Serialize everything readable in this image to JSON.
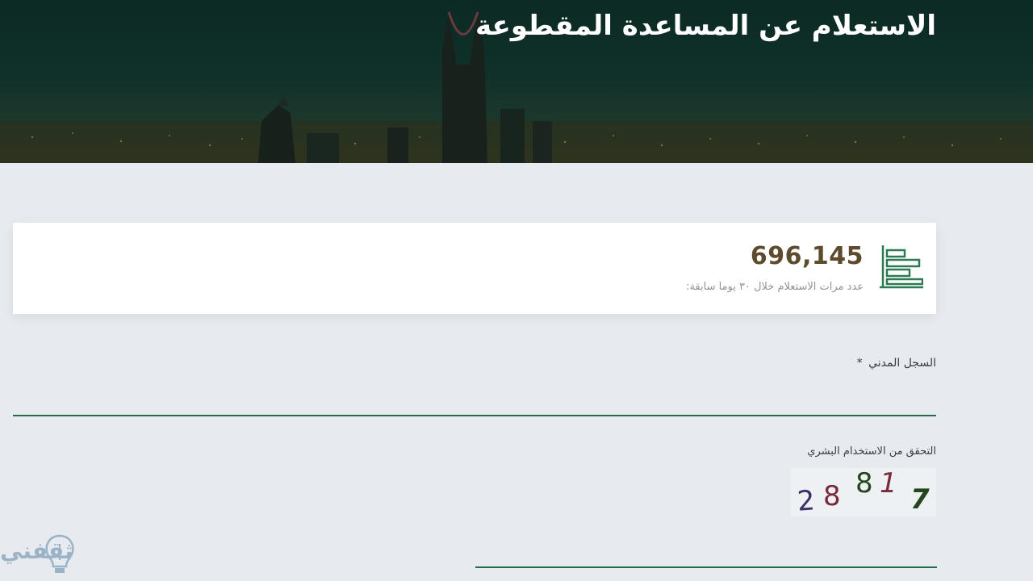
{
  "hero": {
    "title": "الاستعلام عن المساعدة المقطوعة"
  },
  "stats": {
    "count": "696,145",
    "caption": "عدد مرات الاستعلام خلال ٣٠ يوما سابقة:",
    "icon": "bar-chart-icon"
  },
  "form": {
    "national_id": {
      "label": "السجل المدني",
      "required_mark": "*",
      "value": ""
    },
    "captcha": {
      "label": "التحقق من الاستخدام البشري",
      "value": "",
      "characters": [
        "2",
        "8",
        "8",
        "1",
        "7"
      ]
    }
  },
  "watermark": {
    "text": "ثقفني"
  },
  "colors": {
    "accent": "#1f6e49",
    "number": "#5e4a2c",
    "hero_bg": "#10302a",
    "page_bg": "#e7ebef"
  }
}
